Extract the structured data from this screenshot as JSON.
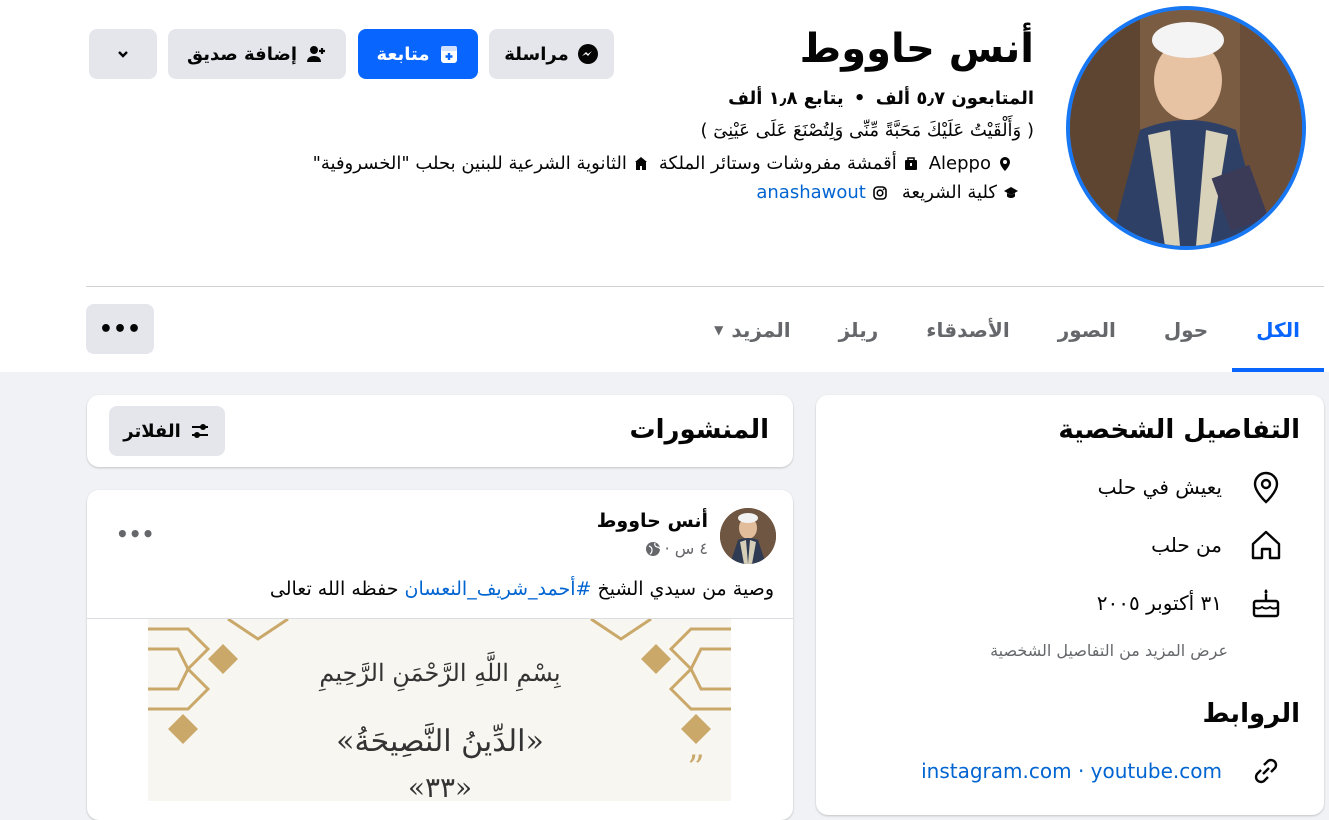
{
  "profile": {
    "name": "أنس حاووط",
    "stats": {
      "followers": "المتابعون ٥٫٧ ألف",
      "dot": "•",
      "following": "يتابع ١٫٨ ألف"
    },
    "bio": "( وَأَلْقَيْتُ عَلَيْكَ مَحَبَّةً مِّنِّى وَلِتُصْنَعَ عَلَى عَيْنِىٓ )",
    "info": {
      "location": "Aleppo",
      "work": "أقمشة مفروشات وستائر الملكة",
      "school": "الثانوية الشرعية للبنين بحلب \"الخسروفية\"",
      "college": "كلية الشريعة",
      "instagram": "anashawout"
    }
  },
  "actions": {
    "message": "مراسلة",
    "follow": "متابعة",
    "add_friend": "إضافة صديق"
  },
  "tabs": [
    {
      "label": "الكل"
    },
    {
      "label": "حول"
    },
    {
      "label": "الصور"
    },
    {
      "label": "الأصدقاء"
    },
    {
      "label": "ريلز"
    },
    {
      "label": "المزيد"
    }
  ],
  "more_menu": "•••",
  "intro": {
    "title": "التفاصيل الشخصية",
    "lives": "يعيش في حلب",
    "from": "من حلب",
    "birthday": "٣١ أكتوبر ٢٠٠٥",
    "see_more": "عرض المزيد من التفاصيل الشخصية",
    "links_title": "الروابط",
    "links": "instagram.com · youtube.com"
  },
  "posts": {
    "title": "المنشورات",
    "filters": "الفلاتر"
  },
  "post": {
    "author": "أنس حاووط",
    "time": "٤ س ·",
    "options": "•••",
    "text_before": "وصية من سيدي الشيخ ",
    "hashtag": "#أحمد_شريف_النعسان",
    "text_after": " حفظه الله تعالى",
    "image_basmala": "بِسْمِ اللَّهِ الرَّحْمَنِ الرَّحِيمِ",
    "image_title": "«الدِّينُ النَّصِيحَةُ»",
    "image_number": "«٣٣»"
  },
  "colors": {
    "accent": "#0866ff",
    "page_bg": "#f0f2f5",
    "gold": "#c9a86a"
  }
}
